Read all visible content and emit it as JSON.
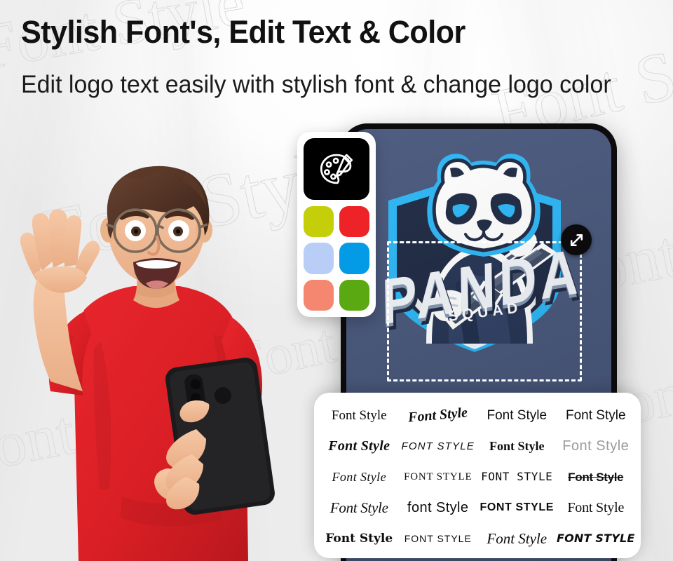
{
  "heading": {
    "title": "Stylish Font's, Edit Text & Color",
    "subtitle": "Edit logo text easily with stylish font & change logo color"
  },
  "background": {
    "watermark_text": "Font Style",
    "watermark_color": "#dcdcdc",
    "base_color": "#f4f4f4"
  },
  "palette_panel": {
    "name": "color-palette-panel",
    "icon_button": {
      "icon": "paint-palette-icon",
      "background": "#000000"
    },
    "swatches": [
      {
        "name": "yellow-green",
        "color": "#c5cf09"
      },
      {
        "name": "red",
        "color": "#ee2327"
      },
      {
        "name": "light-blue",
        "color": "#b8cef7"
      },
      {
        "name": "bright-blue",
        "color": "#039be5"
      },
      {
        "name": "salmon",
        "color": "#f5866f"
      },
      {
        "name": "green",
        "color": "#5aa812"
      }
    ]
  },
  "phone": {
    "frame_color": "#0c0c0e",
    "screen_color": "#46557a",
    "logo": {
      "brand_text": "PANDA",
      "sub_text": "SQUAD",
      "mascot": "panda-mascot-with-rifle",
      "accent_color": "#29b6f6",
      "dark_color": "#1c2a45",
      "light_color": "#f2f5f8",
      "mid_color": "#7f93ad"
    },
    "selection": {
      "handle_icon": "resize-diagonal-icon",
      "handle_color": "#0b0b0d",
      "border_color": "#ffffff",
      "border_style": "dashed"
    }
  },
  "font_panel": {
    "name": "font-styles-panel",
    "columns": 4,
    "rows": 5,
    "samples": [
      {
        "label": "Font Style",
        "style": "f1"
      },
      {
        "label": "Font Style",
        "style": "f2"
      },
      {
        "label": "Font Style",
        "style": "f3"
      },
      {
        "label": "Font Style",
        "style": "f4"
      },
      {
        "label": "Font Style",
        "style": "f5"
      },
      {
        "label": "FONT STYLE",
        "style": "f6"
      },
      {
        "label": "Font Style",
        "style": "f7"
      },
      {
        "label": "Font Style",
        "style": "f8"
      },
      {
        "label": "Font Style",
        "style": "f9"
      },
      {
        "label": "Font Style",
        "style": "f10"
      },
      {
        "label": "FONT STYLE",
        "style": "f11"
      },
      {
        "label": "Font Style",
        "style": "f12"
      },
      {
        "label": "Font Style",
        "style": "f13"
      },
      {
        "label": "font Style",
        "style": "f14"
      },
      {
        "label": "FONT STYLE",
        "style": "f15"
      },
      {
        "label": "Font Style",
        "style": "f16"
      },
      {
        "label": "Font Style",
        "style": "f17"
      },
      {
        "label": "FONT STYLE",
        "style": "f18"
      },
      {
        "label": "Font Style",
        "style": "f19"
      },
      {
        "label": "FONT STYLE",
        "style": "f20"
      }
    ]
  },
  "person": {
    "description": "excited-man-with-glasses-holding-phone",
    "shirt_color": "#dd2127",
    "skin_color": "#f0bb98",
    "hair_color": "#4b3024",
    "held_phone_color": "#1c1c1e"
  }
}
